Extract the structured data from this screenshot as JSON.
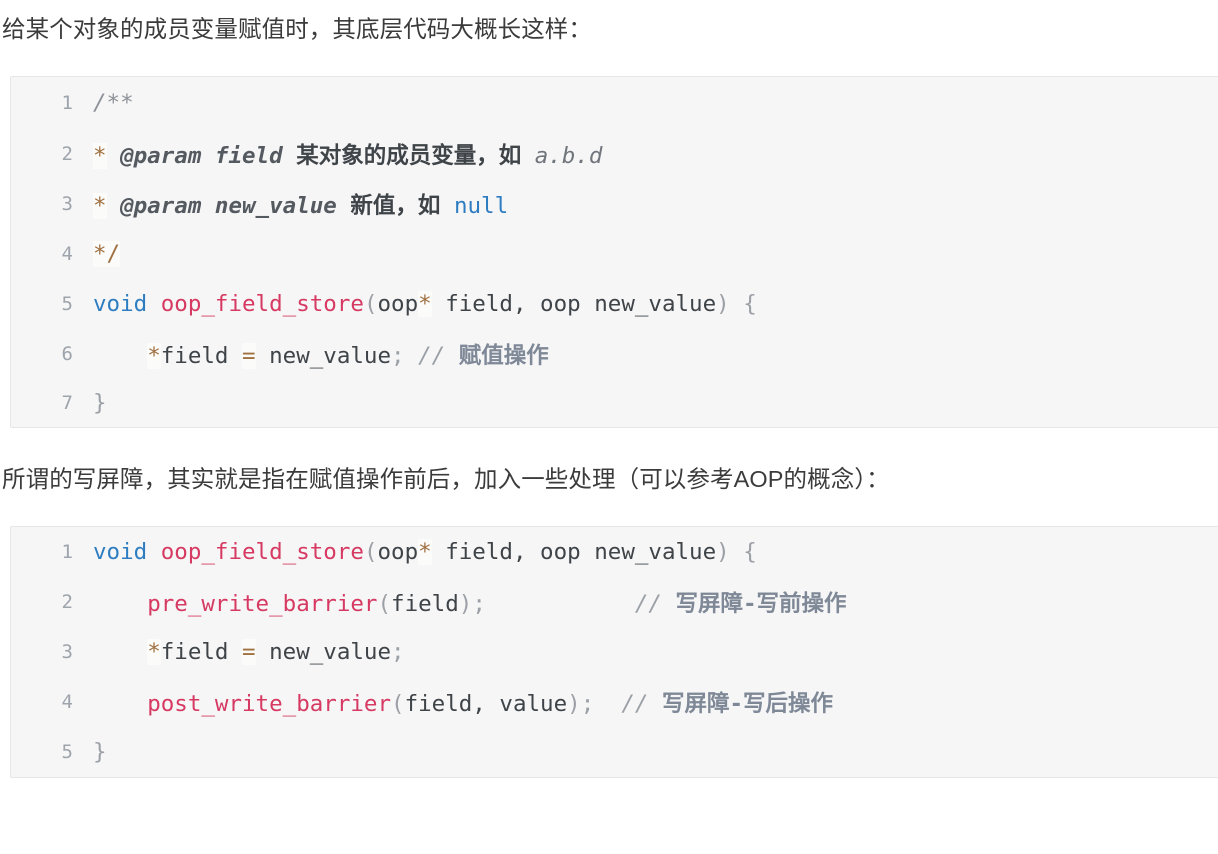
{
  "paragraphs": {
    "p1": "给某个对象的成员变量赋值时，其底层代码大概长这样：",
    "p2": "所谓的写屏障，其实就是指在赋值操作前后，加入一些处理（可以参考AOP的概念）："
  },
  "code_block_1": {
    "language": "c",
    "line_numbers": [
      "1",
      "2",
      "3",
      "4",
      "5",
      "6",
      "7"
    ],
    "lines": [
      "/**",
      " * @param field 某对象的成员变量，如 a.b.d",
      " * @param new_value 新值，如 null",
      " */",
      "void oop_field_store(oop* field, oop new_value) {",
      "    *field = new_value; // 赋值操作",
      "}"
    ],
    "tokens": {
      "l1_comment_open": "/**",
      "l2_star": "*",
      "l2_tag": " @param field ",
      "l2_cn": "某对象的成员变量，如 ",
      "l2_code": "a.b.d",
      "l3_star": "*",
      "l3_tag": " @param new_value ",
      "l3_cn": "新值，如 ",
      "l3_null": "null",
      "l4_close": "*/",
      "l5_kw": "void",
      "l5_fn": "oop_field_store",
      "l5_paren_open": "(",
      "l5_type1": "oop",
      "l5_star": "*",
      "l5_arg1": " field, oop new_value",
      "l5_paren_close": ")",
      "l5_brace": "{",
      "l6_indent": "    ",
      "l6_star": "*",
      "l6_var": "field ",
      "l6_eq": "=",
      "l6_rhs": " new_value",
      "l6_semi": ";",
      "l6_comment_slash": " // ",
      "l6_comment_cn": "赋值操作",
      "l7_brace": "}"
    }
  },
  "code_block_2": {
    "language": "c",
    "line_numbers": [
      "1",
      "2",
      "3",
      "4",
      "5"
    ],
    "lines": [
      "void oop_field_store(oop* field, oop new_value) {",
      "    pre_write_barrier(field);           // 写屏障-写前操作",
      "    *field = new_value;",
      "    post_write_barrier(field, value);  // 写屏障-写后操作",
      "}"
    ],
    "tokens": {
      "l1_kw": "void",
      "l1_fn": "oop_field_store",
      "l1_paren_open": "(",
      "l1_type1": "oop",
      "l1_star": "*",
      "l1_arg1": " field, oop new_value",
      "l1_paren_close": ")",
      "l1_brace": "{",
      "l2_indent": "    ",
      "l2_fn": "pre_write_barrier",
      "l2_paren_open": "(",
      "l2_arg": "field",
      "l2_paren_close": ")",
      "l2_semi": ";",
      "l2_gap": "           ",
      "l2_comment_slash": "// ",
      "l2_comment_cn": "写屏障-写前操作",
      "l3_indent": "    ",
      "l3_star": "*",
      "l3_var": "field ",
      "l3_eq": "=",
      "l3_rhs": " new_value",
      "l3_semi": ";",
      "l4_indent": "    ",
      "l4_fn": "post_write_barrier",
      "l4_paren_open": "(",
      "l4_arg": "field, value",
      "l4_paren_close": ")",
      "l4_semi": ";",
      "l4_gap": "  ",
      "l4_comment_slash": "// ",
      "l4_comment_cn": "写屏障-写后操作",
      "l5_brace": "}"
    }
  },
  "colors": {
    "page_background": "#ffffff",
    "text": "#3b3b3b",
    "code_background": "#f6f6f7",
    "code_border": "#e6e6ea",
    "gutter_text": "#9ea4ab",
    "keyword": "#2f7dc1",
    "function": "#d63a62",
    "operator": "#a07040",
    "punctuation": "#9ba0a6",
    "comment": "#7e8896",
    "plain": "#3f4448"
  }
}
